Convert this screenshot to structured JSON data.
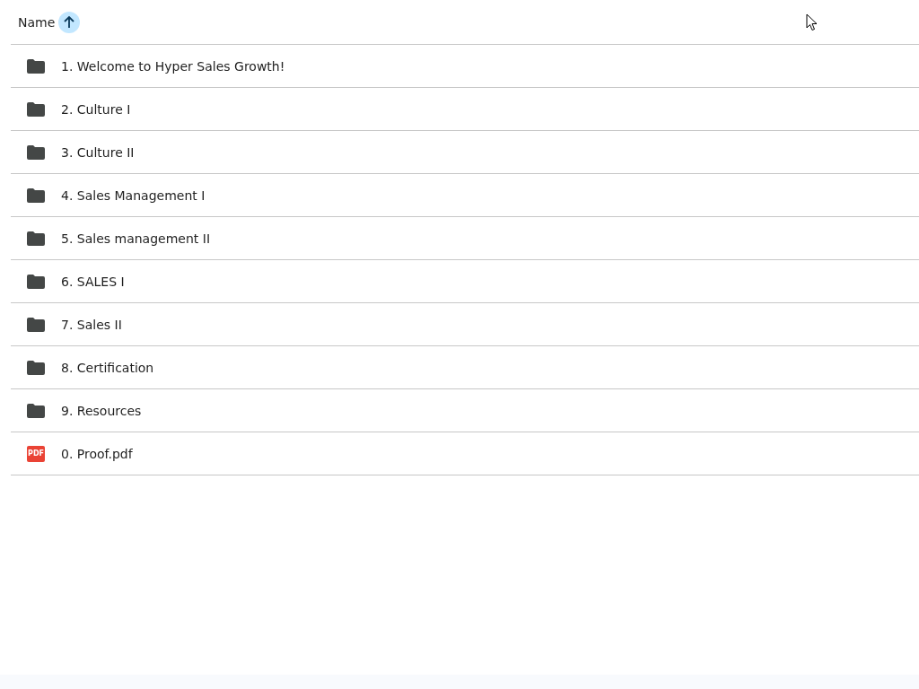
{
  "header": {
    "label": "Name",
    "sort_ascending": true
  },
  "files": [
    {
      "name": "1. Welcome to Hyper Sales Growth!",
      "kind": "folder"
    },
    {
      "name": "2. Culture I",
      "kind": "folder"
    },
    {
      "name": "3. Culture II",
      "kind": "folder"
    },
    {
      "name": "4. Sales Management I",
      "kind": "folder"
    },
    {
      "name": "5. Sales management II",
      "kind": "folder"
    },
    {
      "name": "6. SALES I",
      "kind": "folder"
    },
    {
      "name": "7. Sales II",
      "kind": "folder"
    },
    {
      "name": "8. Certification",
      "kind": "folder"
    },
    {
      "name": "9. Resources",
      "kind": "folder"
    },
    {
      "name": "0. Proof.pdf",
      "kind": "pdf",
      "badge": "PDF"
    }
  ]
}
